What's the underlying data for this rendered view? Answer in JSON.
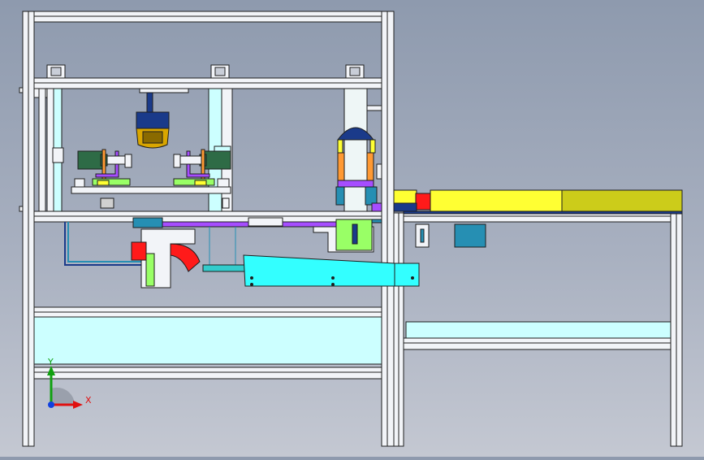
{
  "viewport": {
    "background_top": "#8e9aae",
    "background_bottom": "#c4c8d2",
    "frame_color": "#f2f4f8",
    "edge_color": "#1e1e1e"
  },
  "triad": {
    "x_label": "X",
    "y_label": "Y",
    "x_color": "#e01010",
    "y_color": "#10a010",
    "z_color": "#1040e0"
  },
  "parts": {
    "cyan": "#33ffff",
    "light_cyan": "#ccffff",
    "yellow": "#ffff33",
    "olive": "#cccc1a",
    "red": "#ff1a1a",
    "green_motor": "#2e6b46",
    "purple": "#a64dff",
    "light_green": "#99ff66",
    "orange": "#ff9933",
    "navy": "#1a3a8a",
    "gold": "#d9a600",
    "teal": "#268fb3"
  }
}
